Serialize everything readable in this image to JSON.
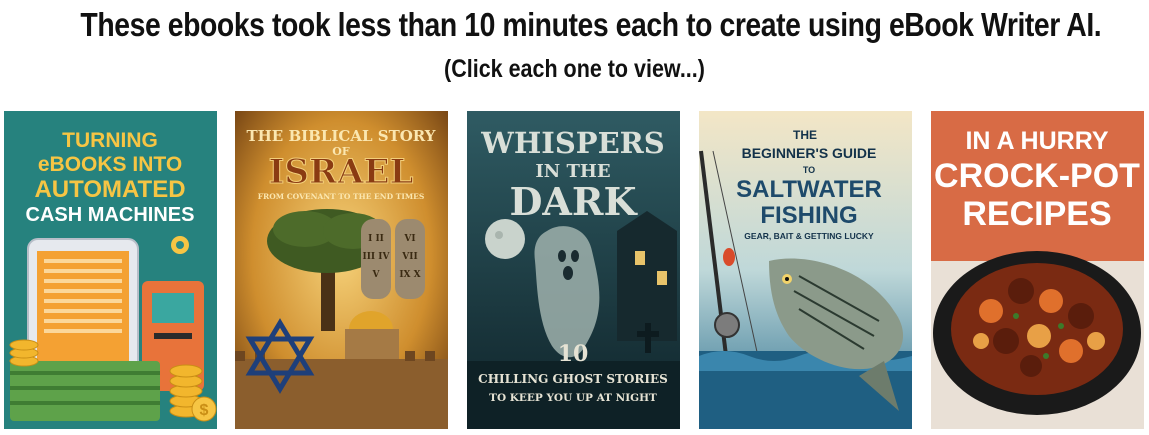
{
  "headline": "These ebooks took less than 10 minutes each to create using eBook Writer AI.",
  "subline": "(Click each one to view...)",
  "books": [
    {
      "lines": [
        "TURNING",
        "eBOOKS INTO",
        "AUTOMATED",
        "CASH MACHINES"
      ],
      "bg": "#2a8a86"
    },
    {
      "lines": [
        "THE BIBLICAL STORY",
        "OF",
        "ISRAEL",
        "FROM COVENANT TO THE END TIMES"
      ],
      "tablet_left": "I\nII\nIII\nIV\nV",
      "tablet_right": "VI\nVII\nVIII\nIX\nX",
      "bg": "#c98a2a"
    },
    {
      "lines": [
        "WHISPERS",
        "IN THE",
        "DARK",
        "10",
        "CHILLING GHOST STORIES",
        "TO KEEP YOU UP AT NIGHT"
      ],
      "bg": "#1f4a55"
    },
    {
      "lines": [
        "THE",
        "BEGINNER'S GUIDE",
        "TO",
        "SALTWATER",
        "FISHING",
        "GEAR, BAIT & GETTING LUCKY"
      ],
      "bg": "#2b7fa3"
    },
    {
      "lines": [
        "IN A HURRY",
        "CROCK-POT",
        "RECIPES"
      ],
      "bg": "#d86b45"
    }
  ]
}
